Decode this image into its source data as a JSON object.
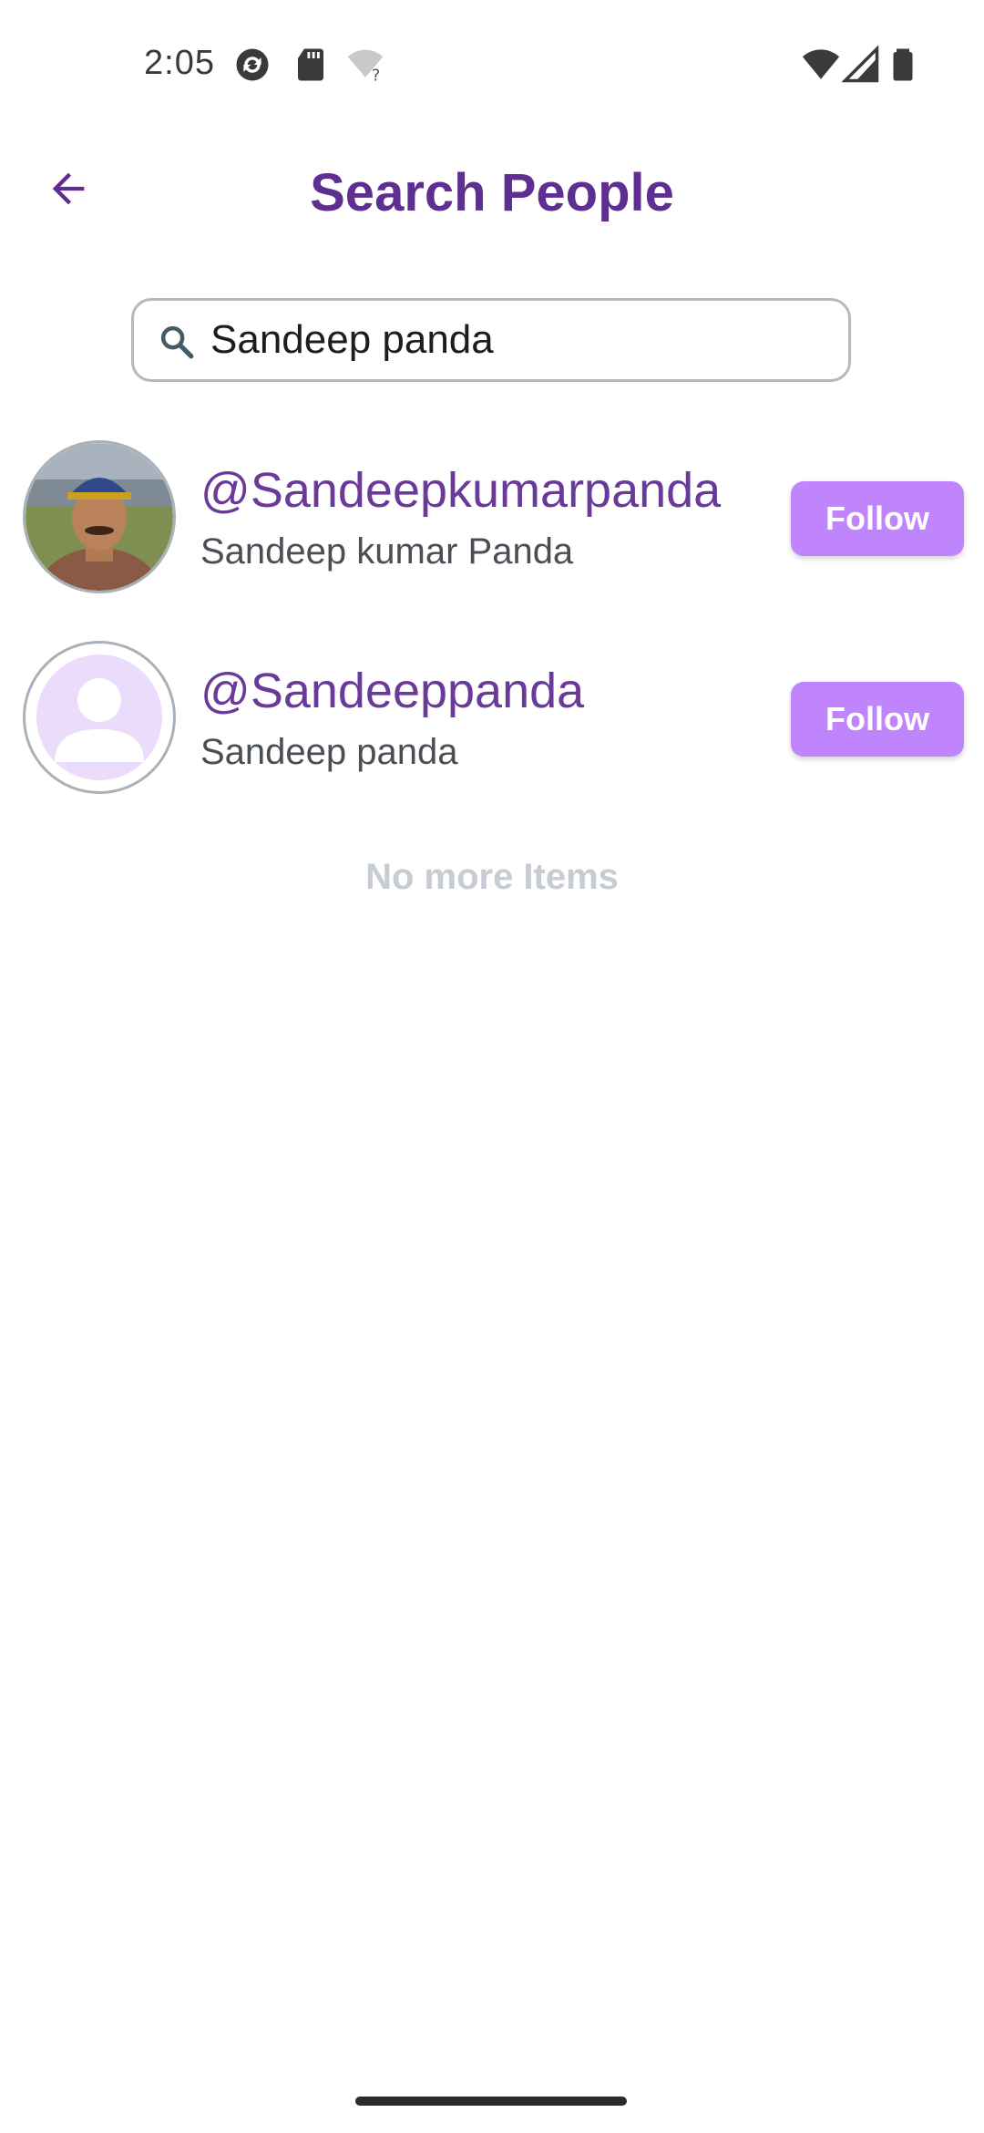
{
  "status_bar": {
    "time": "2:05",
    "icons": [
      "sync-icon",
      "sd-card-icon",
      "wifi-unknown-icon",
      "wifi-icon",
      "cell-signal-icon",
      "battery-icon"
    ]
  },
  "header": {
    "title": "Search People",
    "back_icon": "back-arrow-icon"
  },
  "search": {
    "value": "Sandeep panda",
    "icon": "search-icon"
  },
  "results": [
    {
      "handle": "@Sandeepkumarpanda",
      "name": "Sandeep kumar Panda",
      "button_label": "Follow",
      "avatar": "profile-photo"
    },
    {
      "handle": "@Sandeeppanda",
      "name": "Sandeep panda",
      "button_label": "Follow",
      "avatar": "default-avatar-icon"
    }
  ],
  "footer_text": "No more Items",
  "colors": {
    "brand": "#5e2e91",
    "accent": "#c084fc",
    "handle": "#6a3a9a"
  }
}
